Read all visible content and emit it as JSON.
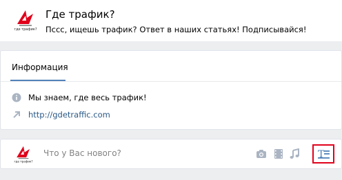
{
  "header": {
    "group_name": "Где трафик?",
    "status": "Пссс, ищешь трафик? Ответ в наших статьях! Подписывайся!",
    "logo_caption": "где трафик?"
  },
  "info": {
    "tab_label": "Информация",
    "description": "Мы знаем, где весь трафик!",
    "link": "http://gdetraffic.com"
  },
  "post": {
    "placeholder": "Что у Вас нового?",
    "icons": [
      "camera-icon",
      "video-icon",
      "music-icon",
      "article-icon"
    ]
  },
  "colors": {
    "background": "#edeef0",
    "accent": "#5181b8",
    "link": "#2a5885",
    "highlight": "#e0001b",
    "icon": "#aab4c2"
  }
}
